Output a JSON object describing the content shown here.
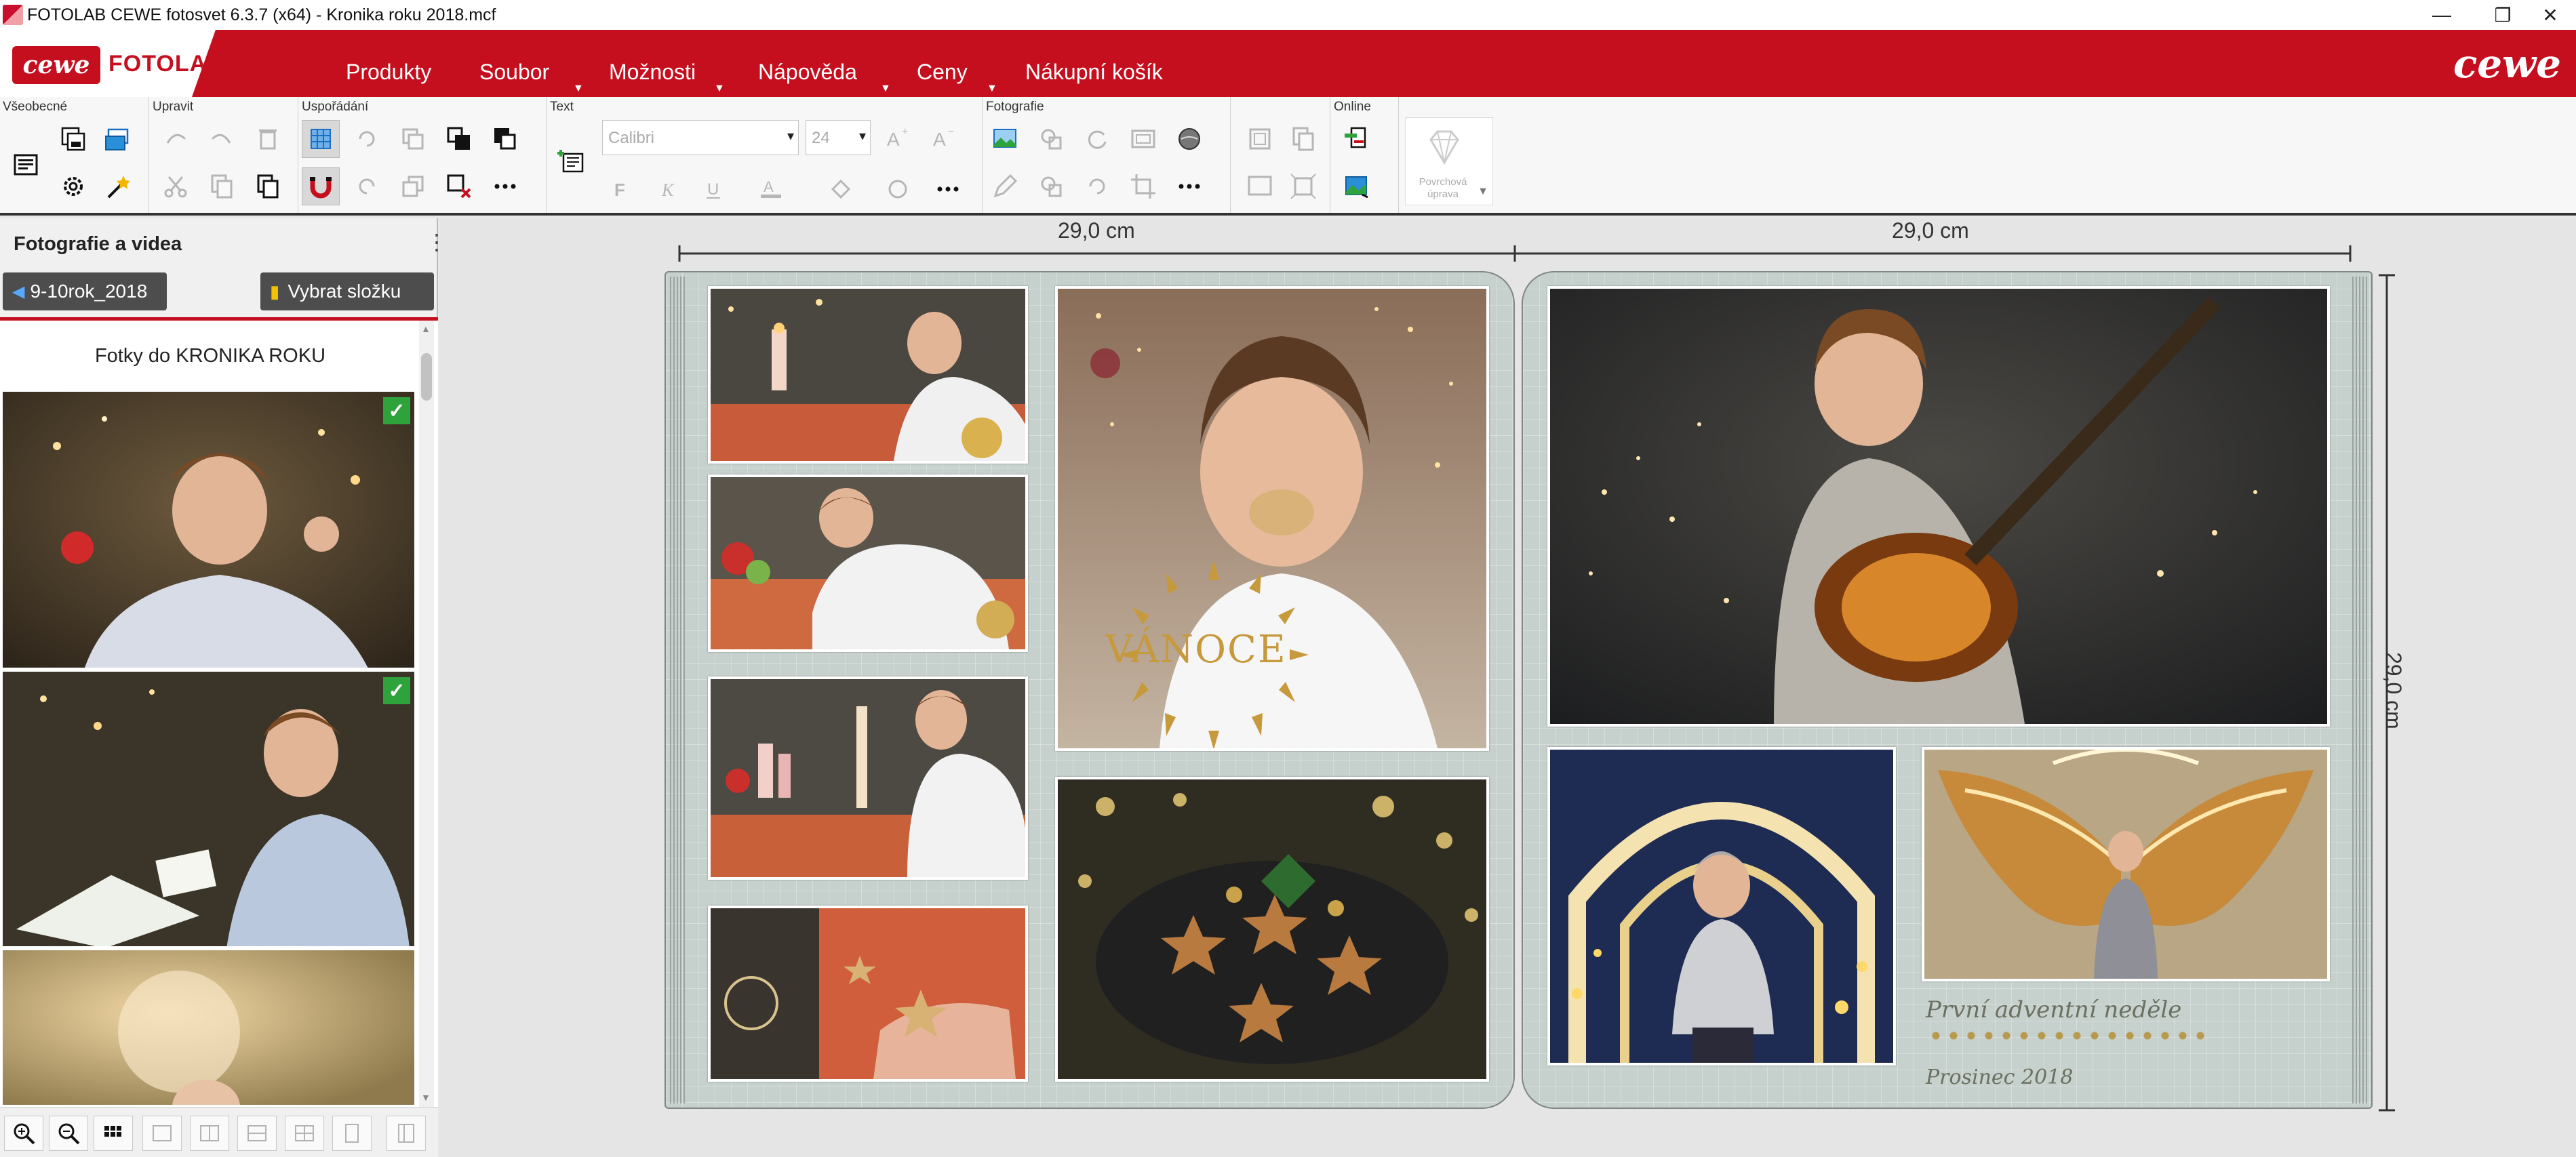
{
  "window": {
    "title": "FOTOLAB CEWE fotosvet 6.3.7 (x64) - Kronika roku 2018.mcf",
    "minimize": "—",
    "restore": "❐",
    "close": "✕"
  },
  "brand": {
    "badge": "cewe",
    "name": "FOTOLAB",
    "right_logo": "cewe",
    "accent_color": "#c50f1f"
  },
  "menu": {
    "items": [
      {
        "label": "Produkty"
      },
      {
        "label": "Soubor"
      },
      {
        "label": "Možnosti"
      },
      {
        "label": "Nápověda"
      },
      {
        "label": "Ceny"
      },
      {
        "label": "Nákupní košík"
      }
    ]
  },
  "ribbon": {
    "groups": {
      "general": "Všeobecné",
      "edit": "Upravit",
      "arrange": "Uspořádání",
      "text": "Text",
      "photos": "Fotografie",
      "online": "Online"
    },
    "font": "Calibri",
    "size": "24",
    "surface": "Povrchová úprava"
  },
  "left_panel": {
    "header": "Fotografie a videa",
    "folder": "9-10rok_2018",
    "choose_folder": "Vybrat složku",
    "album_caption": "Fotky do KRONIKA ROKU",
    "check": "✓"
  },
  "workspace": {
    "dim_left": "29,0 cm",
    "dim_right": "29,0 cm",
    "dim_height": "29,0 cm",
    "stamp_text": "VÁNOCE",
    "caption1": "První adventní neděle",
    "caption2": "Prosinec 2018"
  }
}
